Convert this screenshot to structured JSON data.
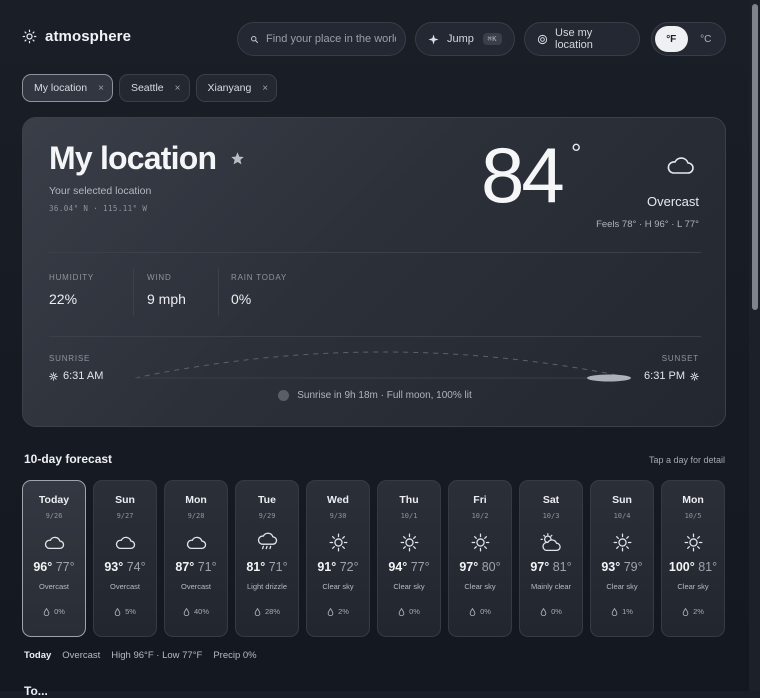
{
  "brand": {
    "name": "atmosphere",
    "icon": "sun-icon"
  },
  "search": {
    "placeholder": "Find your place in the world",
    "icon": "search-icon"
  },
  "jump": {
    "label": "Jump",
    "shortcut": "⌘K",
    "icon": "sparkle-icon"
  },
  "geolocate": {
    "label": "Use my location",
    "icon": "target-icon"
  },
  "units": {
    "fahrenheit": "°F",
    "celsius": "°C",
    "selected": "fahrenheit"
  },
  "chips": [
    {
      "label": "My location",
      "active": true
    },
    {
      "label": "Seattle",
      "active": false
    },
    {
      "label": "Xianyang",
      "active": false
    }
  ],
  "current": {
    "title": "My location",
    "subtitle": "Your selected location",
    "coords": "36.04° N · 115.11° W",
    "temp": "84",
    "degree": "°",
    "condition": "Overcast",
    "condition_icon": "cloud-icon",
    "feels": "Feels 78° · H 96° · L 77°",
    "stats": [
      {
        "label": "Humidity",
        "value": "22%"
      },
      {
        "label": "Wind",
        "value": "9 mph"
      },
      {
        "label": "Rain today",
        "value": "0%"
      }
    ],
    "sunrise": {
      "label": "SUNRISE",
      "time": "6:31 AM"
    },
    "sunset": {
      "label": "SUNSET",
      "time": "6:31 PM"
    },
    "moon": "Sunrise in 9h 18m · Full moon, 100% lit"
  },
  "forecast": {
    "title": "10-day forecast",
    "hint": "Tap a day for detail",
    "days": [
      {
        "name": "Today",
        "date": "9/26",
        "icon": "cloud",
        "hi": "96°",
        "lo": "77°",
        "desc": "Overcast",
        "precip": "0%",
        "selected": true
      },
      {
        "name": "Sun",
        "date": "9/27",
        "icon": "cloud",
        "hi": "93°",
        "lo": "74°",
        "desc": "Overcast",
        "precip": "5%",
        "selected": false
      },
      {
        "name": "Mon",
        "date": "9/28",
        "icon": "cloud",
        "hi": "87°",
        "lo": "71°",
        "desc": "Overcast",
        "precip": "40%",
        "selected": false
      },
      {
        "name": "Tue",
        "date": "9/29",
        "icon": "drizzle",
        "hi": "81°",
        "lo": "71°",
        "desc": "Light drizzle",
        "precip": "28%",
        "selected": false
      },
      {
        "name": "Wed",
        "date": "9/30",
        "icon": "sun",
        "hi": "91°",
        "lo": "72°",
        "desc": "Clear sky",
        "precip": "2%",
        "selected": false
      },
      {
        "name": "Thu",
        "date": "10/1",
        "icon": "sun",
        "hi": "94°",
        "lo": "77°",
        "desc": "Clear sky",
        "precip": "0%",
        "selected": false
      },
      {
        "name": "Fri",
        "date": "10/2",
        "icon": "sun",
        "hi": "97°",
        "lo": "80°",
        "desc": "Clear sky",
        "precip": "0%",
        "selected": false
      },
      {
        "name": "Sat",
        "date": "10/3",
        "icon": "partly",
        "hi": "97°",
        "lo": "81°",
        "desc": "Mainly clear",
        "precip": "0%",
        "selected": false
      },
      {
        "name": "Sun",
        "date": "10/4",
        "icon": "sun",
        "hi": "93°",
        "lo": "79°",
        "desc": "Clear sky",
        "precip": "1%",
        "selected": false
      },
      {
        "name": "Mon",
        "date": "10/5",
        "icon": "sun",
        "hi": "100°",
        "lo": "81°",
        "desc": "Clear sky",
        "precip": "2%",
        "selected": false
      }
    ]
  },
  "summary": {
    "day": "Today",
    "condition": "Overcast",
    "hilo": "High 96°F · Low 77°F",
    "precip": "Precip 0%"
  },
  "next_section": {
    "title": "To..."
  }
}
